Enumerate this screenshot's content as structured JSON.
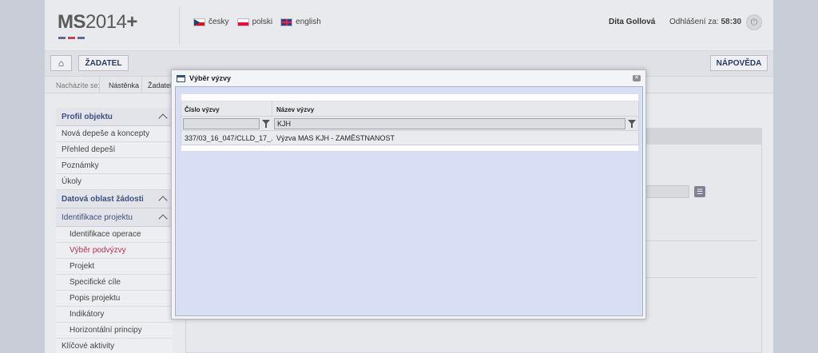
{
  "header": {
    "logo_main": "MS",
    "logo_year": "2014",
    "logo_plus": "+",
    "languages": [
      {
        "label": "česky",
        "icon": "czech-flag-icon"
      },
      {
        "label": "polski",
        "icon": "polish-flag-icon"
      },
      {
        "label": "english",
        "icon": "uk-flag-icon"
      }
    ],
    "user_name": "Dita Gollová",
    "logout_label": "Odhlášení za:",
    "logout_time": "58:30"
  },
  "toolbar": {
    "zadatel_label": "ŽADATEL",
    "napoveda_label": "NÁPOVĚDA"
  },
  "breadcrumb": {
    "prefix": "Nacházíte se:",
    "items": [
      "Nástěnka",
      "Žadatel"
    ]
  },
  "sidebar": {
    "items": [
      {
        "label": "Profil objektu",
        "type": "head"
      },
      {
        "label": "Nová depeše a koncepty",
        "type": "item"
      },
      {
        "label": "Přehled depeší",
        "type": "item"
      },
      {
        "label": "Poznámky",
        "type": "item"
      },
      {
        "label": "Úkoly",
        "type": "item"
      },
      {
        "label": "Datová oblast žádosti",
        "type": "head"
      },
      {
        "label": "Identifikace projektu",
        "type": "head"
      },
      {
        "label": "Identifikace operace",
        "type": "sub"
      },
      {
        "label": "Výběr podvýzvy",
        "type": "sub-active"
      },
      {
        "label": "Projekt",
        "type": "sub"
      },
      {
        "label": "Specifické cíle",
        "type": "sub"
      },
      {
        "label": "Popis projektu",
        "type": "sub"
      },
      {
        "label": "Indikátory",
        "type": "sub"
      },
      {
        "label": "Horizontální principy",
        "type": "sub"
      },
      {
        "label": "Klíčové aktivity",
        "type": "item"
      }
    ]
  },
  "modal": {
    "title": "Výběr výzvy",
    "columns": [
      "Číslo výzvy",
      "Název výzvy"
    ],
    "filters": {
      "col1": "",
      "col2": "KJH"
    },
    "rows": [
      {
        "cislo": "337/03_16_047/CLLD_17_...",
        "nazev": "Výzva MAS KJH - ZAMĚSTNANOST"
      }
    ]
  },
  "colors": {
    "accent": "#3e4f7c",
    "active_item": "#b8314a",
    "modal_body": "#d8dff4"
  }
}
